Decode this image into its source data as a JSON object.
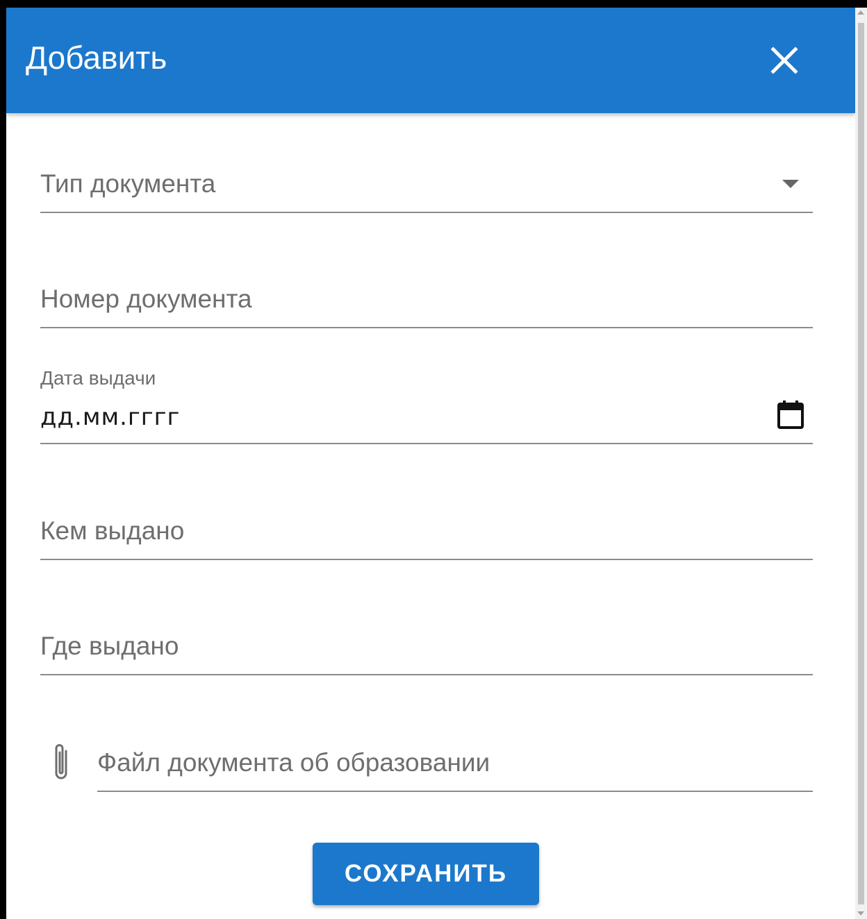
{
  "dialog": {
    "title": "Добавить",
    "close_icon": "close-icon"
  },
  "colors": {
    "primary": "#1c78cc",
    "underline": "#8a8a8a",
    "label": "#6e6e6e"
  },
  "form": {
    "document_type": {
      "label": "Тип документа",
      "icon": "dropdown-arrow-icon"
    },
    "document_number": {
      "label": "Номер документа"
    },
    "issue_date": {
      "label": "Дата выдачи",
      "value": "дд.мм.гггг",
      "icon": "calendar-icon"
    },
    "issued_by": {
      "label": "Кем выдано"
    },
    "issued_where": {
      "label": "Где выдано"
    },
    "education_file": {
      "label": "Файл документа об образовании",
      "icon": "paperclip-icon"
    }
  },
  "actions": {
    "save_label": "СОХРАНИТЬ"
  }
}
